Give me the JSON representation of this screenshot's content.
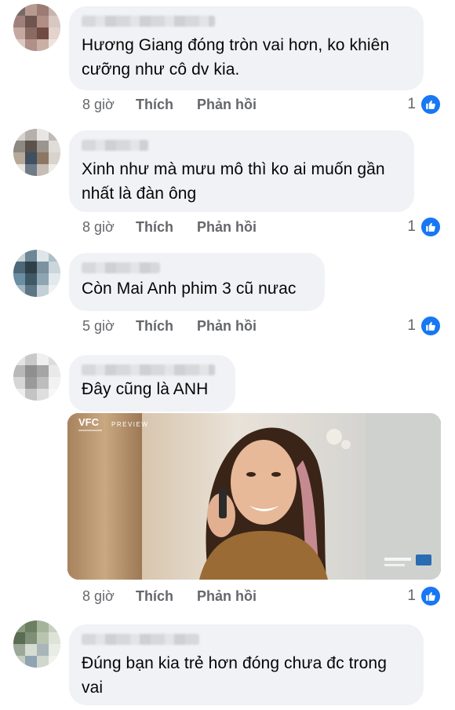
{
  "comments": [
    {
      "text_lines": [
        "Hương Giang đóng tròn vai hơn, ko khiên",
        "cưỡng như cô dv kia."
      ],
      "time": "8 giờ",
      "like": "Thích",
      "reply": "Phản hồi",
      "reactions": "1"
    },
    {
      "text_lines": [
        "Xinh như mà mưu mô thì ko ai muốn gần",
        "nhất là đàn ông"
      ],
      "time": "8 giờ",
      "like": "Thích",
      "reply": "Phản hồi",
      "reactions": "1"
    },
    {
      "text_lines": [
        "Còn Mai Anh phim 3 cũ nưac"
      ],
      "time": "5 giờ",
      "like": "Thích",
      "reply": "Phản hồi",
      "reactions": "1"
    },
    {
      "text_lines": [
        "Đây cũng là ANH"
      ],
      "time": "8 giờ",
      "like": "Thích",
      "reply": "Phản hồi",
      "reactions": "1",
      "attachment": {
        "logo": "VFC",
        "badge": "PREVIEW"
      }
    },
    {
      "text_lines": [
        "Đúng bạn kia trẻ hơn đóng chưa đc trong",
        "vai"
      ]
    }
  ],
  "icons": {
    "reaction": "like-thumbs-up-icon",
    "avatar": "user-avatar-pixelated"
  },
  "colors": {
    "bubble": "#f0f2f5",
    "secondary_text": "#65676b",
    "like_blue": "#1877f2"
  }
}
